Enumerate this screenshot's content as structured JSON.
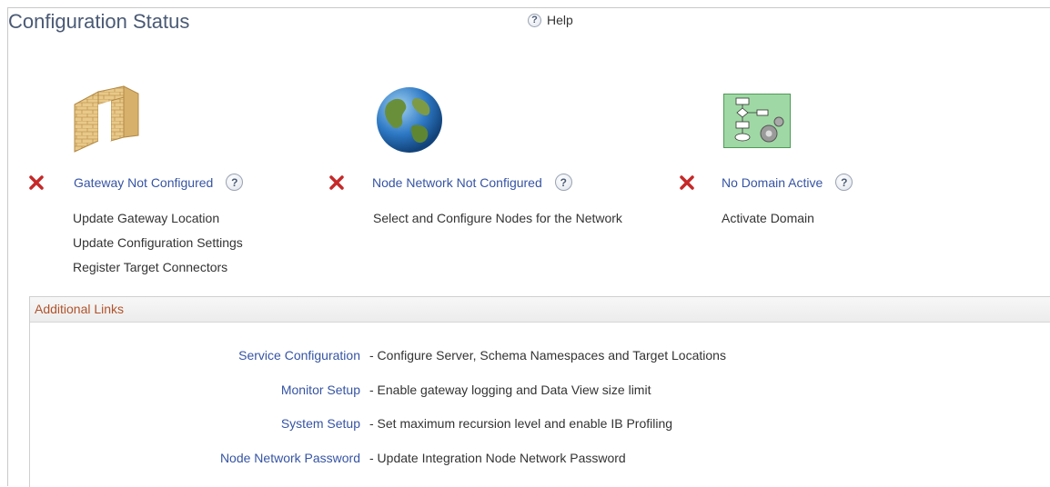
{
  "header": {
    "title": "Configuration Status",
    "help_label": "Help",
    "help_icon": "question-circle-icon"
  },
  "status_items": [
    {
      "name": "gateway",
      "icon": "brick-wall-icon",
      "status_icon": "red-x-icon",
      "status_label": "Gateway Not Configured",
      "actions": [
        "Update Gateway Location",
        "Update Configuration Settings",
        "Register Target Connectors"
      ]
    },
    {
      "name": "node-network",
      "icon": "globe-icon",
      "status_icon": "red-x-icon",
      "status_label": "Node Network Not Configured",
      "actions": [
        "Select and Configure Nodes for the Network"
      ]
    },
    {
      "name": "domain",
      "icon": "flowchart-gear-icon",
      "status_icon": "red-x-icon",
      "status_label": "No Domain Active",
      "actions": [
        "Activate Domain"
      ]
    }
  ],
  "additional_links": {
    "title": "Additional Links",
    "links": [
      {
        "label": "Service Configuration",
        "desc": "- Configure Server, Schema Namespaces and Target Locations"
      },
      {
        "label": "Monitor Setup",
        "desc": "- Enable gateway logging and Data View size limit"
      },
      {
        "label": "System Setup",
        "desc": "- Set maximum recursion level and enable IB Profiling"
      },
      {
        "label": "Node Network Password",
        "desc": "- Update Integration Node Network Password"
      }
    ]
  },
  "colors": {
    "link": "#3654a4",
    "title": "#4a5a75",
    "error": "#c62828",
    "panel_header_text": "#b0532b"
  }
}
